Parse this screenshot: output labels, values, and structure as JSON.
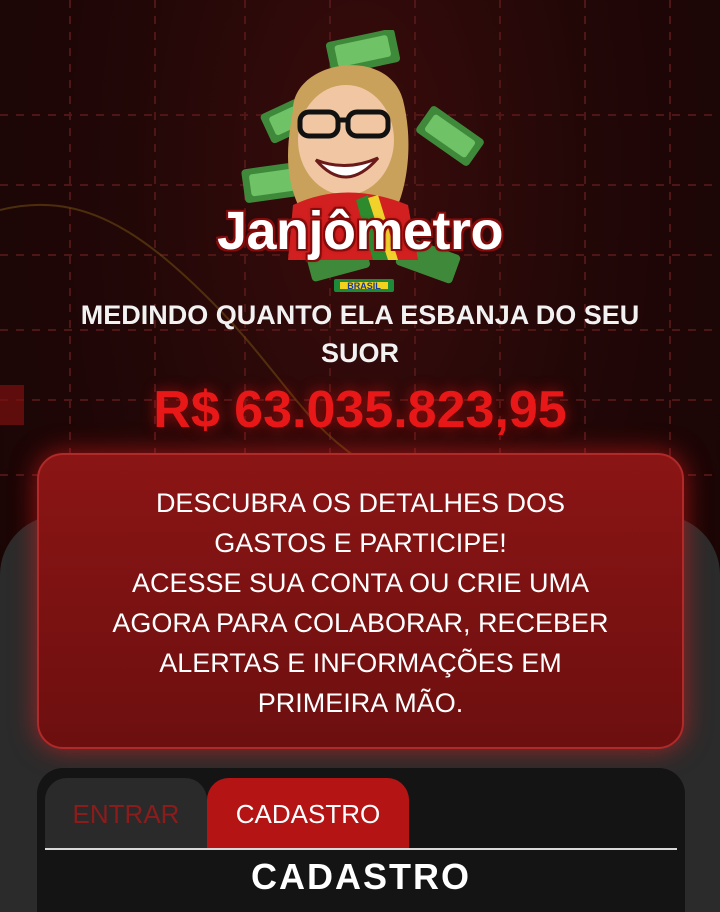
{
  "brand": {
    "name": "Janjômetro",
    "tag": "BRASIL"
  },
  "header": {
    "subtitle": "MEDINDO QUANTO ELA ESBANJA DO SEU SUOR",
    "counter": "R$ 63.035.823,95"
  },
  "info": {
    "lines": [
      "DESCUBRA OS DETALHES DOS",
      "GASTOS E PARTICIPE!",
      "ACESSE SUA CONTA OU CRIE UMA",
      "AGORA PARA COLABORAR, RECEBER",
      "ALERTAS E INFORMAÇÕES EM",
      "PRIMEIRA MÃO."
    ]
  },
  "auth": {
    "tabs": [
      {
        "label": "ENTRAR",
        "active": false
      },
      {
        "label": "CADASTRO",
        "active": true
      }
    ],
    "section_title": "CADASTRO"
  },
  "colors": {
    "accent": "#b51414",
    "counter": "#e81818",
    "info_box": "#8b1515",
    "background": "#1a0606"
  },
  "icons": {
    "logo": "caricature-money-logo-icon"
  }
}
